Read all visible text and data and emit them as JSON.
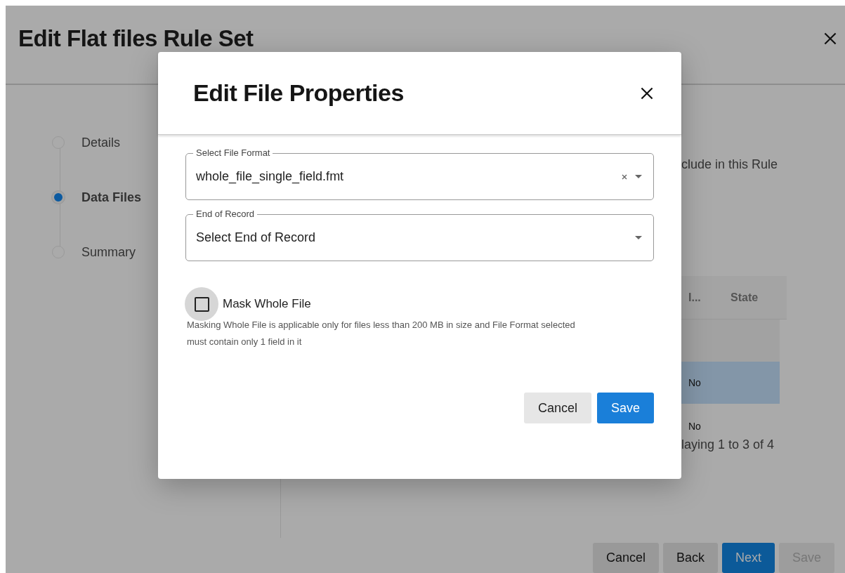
{
  "page": {
    "title": "Edit Flat files Rule Set",
    "stepper": [
      {
        "label": "Details",
        "selected": false
      },
      {
        "label": "Data Files",
        "selected": true
      },
      {
        "label": "Summary",
        "selected": false
      }
    ],
    "intro_text": "clude in this Rule",
    "table": {
      "columns": [
        "I...",
        "State"
      ],
      "rows": [
        {
          "selected": false
        },
        {
          "cells": [
            "No"
          ],
          "selected": true
        },
        {
          "cells": [
            "No"
          ],
          "selected": false
        }
      ]
    },
    "pagination": "laying 1 to 3 of 4",
    "buttons": [
      {
        "label": "Cancel",
        "kind": "secondary",
        "disabled": false
      },
      {
        "label": "Back",
        "kind": "secondary",
        "disabled": false
      },
      {
        "label": "Next",
        "kind": "primary",
        "disabled": false
      },
      {
        "label": "Save",
        "kind": "secondary",
        "disabled": true
      }
    ]
  },
  "dialog": {
    "title": "Edit File Properties",
    "fields": [
      {
        "label": "Select File Format",
        "value": "whole_file_single_field.fmt",
        "clearable": true
      },
      {
        "label": "End of Record",
        "placeholder": "Select End of Record",
        "clearable": false
      }
    ],
    "checkbox": {
      "label": "Mask Whole File",
      "checked": false,
      "focused": true
    },
    "help_text": "Masking Whole File is applicable only for files less than 200 MB in size and File Format selected must contain only 1 field in it",
    "buttons": [
      {
        "label": "Cancel",
        "kind": "secondary"
      },
      {
        "label": "Save",
        "kind": "primary"
      }
    ]
  }
}
